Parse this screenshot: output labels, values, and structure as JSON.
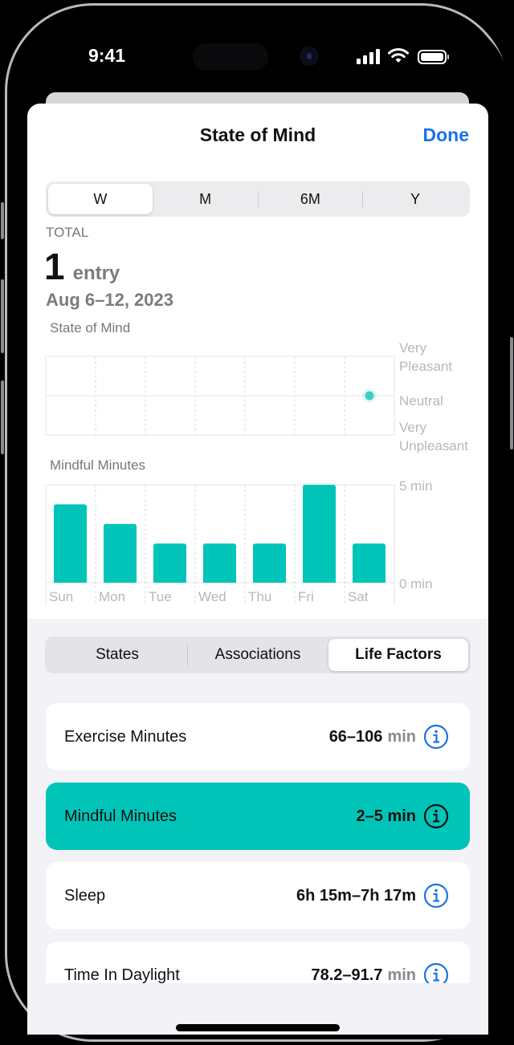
{
  "status_bar": {
    "time": "9:41",
    "icons": [
      "cellular-signal-icon",
      "wifi-icon",
      "battery-icon"
    ]
  },
  "nav": {
    "title": "State of Mind",
    "done_label": "Done"
  },
  "period_tabs": [
    {
      "label": "W",
      "active": true
    },
    {
      "label": "M",
      "active": false
    },
    {
      "label": "6M",
      "active": false
    },
    {
      "label": "Y",
      "active": false
    }
  ],
  "summary": {
    "total_label": "TOTAL",
    "count": "1",
    "unit": "entry",
    "date_range": "Aug 6–12, 2023"
  },
  "chart_data": [
    {
      "type": "scatter",
      "title": "State of Mind",
      "categories": [
        "Sun",
        "Mon",
        "Tue",
        "Wed",
        "Thu",
        "Fri",
        "Sat"
      ],
      "y_labels": [
        "Very Pleasant",
        "Neutral",
        "Very Unpleasant"
      ],
      "ylim": [
        -1,
        1
      ],
      "points": [
        {
          "x": "Sat",
          "y": 0
        }
      ],
      "point_color": "#3ccfc2",
      "grid": true
    },
    {
      "type": "bar",
      "title": "Mindful Minutes",
      "categories": [
        "Sun",
        "Mon",
        "Tue",
        "Wed",
        "Thu",
        "Fri",
        "Sat"
      ],
      "values": [
        4,
        3,
        2,
        2,
        2,
        5,
        2
      ],
      "y_ticks": [
        "5 min",
        "0 min"
      ],
      "ylim": [
        0,
        5
      ],
      "bar_color": "#00c4b8",
      "grid": true
    }
  ],
  "detail_tabs": [
    {
      "label": "States",
      "active": false
    },
    {
      "label": "Associations",
      "active": false
    },
    {
      "label": "Life Factors",
      "active": true
    }
  ],
  "life_factors": [
    {
      "name": "Exercise Minutes",
      "value": "66–106",
      "unit": "min",
      "highlighted": false
    },
    {
      "name": "Mindful Minutes",
      "value": "2–5 min",
      "unit": "",
      "highlighted": true
    },
    {
      "name": "Sleep",
      "value": "6h 15m–7h 17m",
      "unit": "",
      "highlighted": false
    },
    {
      "name": "Time In Daylight",
      "value": "78.2–91.7",
      "unit": "min",
      "highlighted": false
    }
  ],
  "colors": {
    "accent": "#1a73e8",
    "teal": "#00c4b8"
  }
}
